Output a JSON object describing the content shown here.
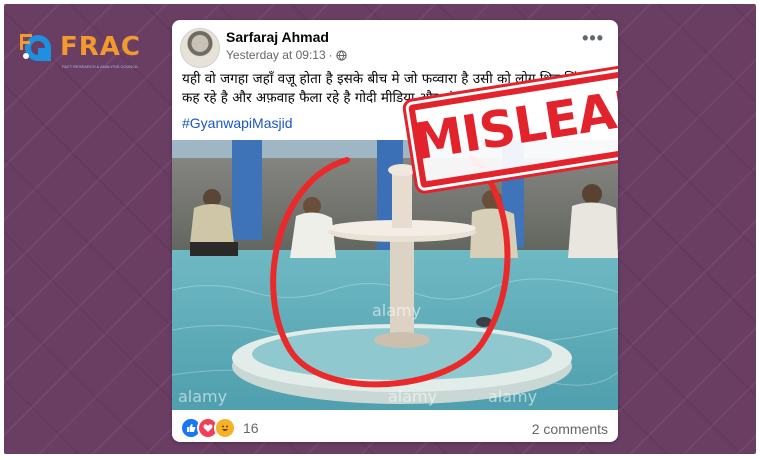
{
  "brand": {
    "logo_text": "FRAC",
    "logo_subtext": "FACT RESEARCH & ANALYSIS COUNCIL",
    "accent": "#f29a2e"
  },
  "post": {
    "author": "Sarfaraj Ahmad",
    "time": "Yesterday at 09:13",
    "separator": "·",
    "visibility_icon": "globe-icon",
    "more_label": "•••",
    "text_line1": "यही वो जगहा जहाँ वज़ू होता है इसके बीच मे जो फव्वारा है उसी को लोग शिव लिंग",
    "text_line2": "कह रहे है और अफ़वाह फैला रहे है गोदी मीडिया और अंधभक्त",
    "hashtag": "#GyanwapiMasjid",
    "image_watermarks": [
      "alamy",
      "alamy",
      "alamy",
      "alamy"
    ],
    "stamp_label": "MISLEADING",
    "stamp_color": "#e3232c"
  },
  "footer": {
    "reaction_icons": [
      "like-icon",
      "love-icon",
      "haha-icon"
    ],
    "reaction_count": "16",
    "comments_label": "2 comments"
  },
  "colors": {
    "background": "#6a3d63",
    "link": "#1b55c6",
    "secondary_text": "#65676b"
  }
}
